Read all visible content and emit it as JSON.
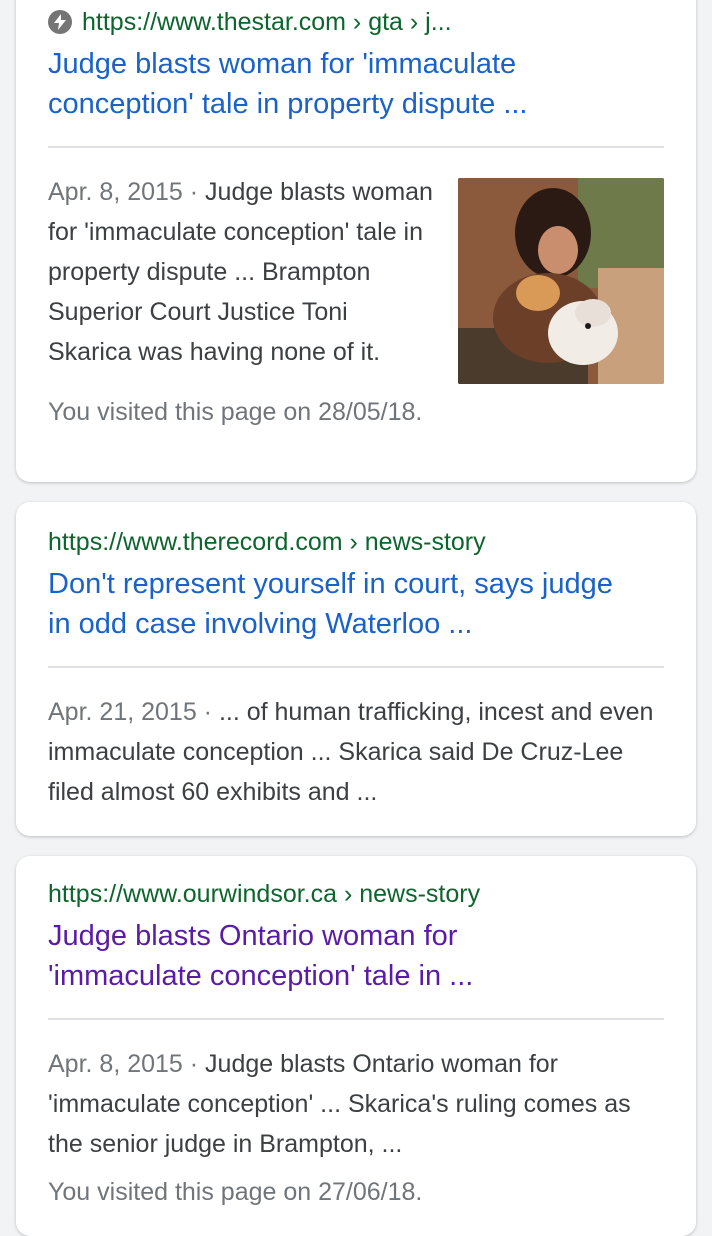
{
  "results": [
    {
      "url": "https://www.thestar.com › gta › j...",
      "title_line1": "Judge blasts woman for 'immaculate",
      "title_line2": "conception' tale in property dispute ...",
      "date": "Apr. 8, 2015 · ",
      "snippet": "Judge blasts woman for 'immaculate conception' tale in property dispute ... Brampton Superior Court Justice Toni Skarica was having none of it.",
      "visited_note": "You visited this page on 28/05/18.",
      "has_amp_icon": true,
      "thumbnail_icon": "photo-thumbnail"
    },
    {
      "url": "https://www.therecord.com › news-story",
      "title_line1": "Don't represent yourself in court, says judge",
      "title_line2": "in odd case involving Waterloo ...",
      "date": "Apr. 21, 2015 · ",
      "snippet": "... of human trafficking, incest and even immaculate conception ... Skarica said De Cruz-Lee filed almost 60 exhibits and  ..."
    },
    {
      "url": "https://www.ourwindsor.ca › news-story",
      "title_line1": "Judge blasts Ontario woman for",
      "title_line2": "'immaculate conception' tale in ...",
      "date": "Apr. 8, 2015 · ",
      "snippet": "Judge blasts Ontario woman for 'immaculate conception' ... Skarica's ruling comes as the senior judge in Brampton, ...",
      "visited_note": "You visited this page on 27/06/18."
    }
  ],
  "colors": {
    "url": "#0d652d",
    "link": "#1a62c8",
    "visited_link": "#5a1ba6",
    "text": "#3c4043",
    "meta": "#70757a",
    "background": "#f1f3f4"
  }
}
